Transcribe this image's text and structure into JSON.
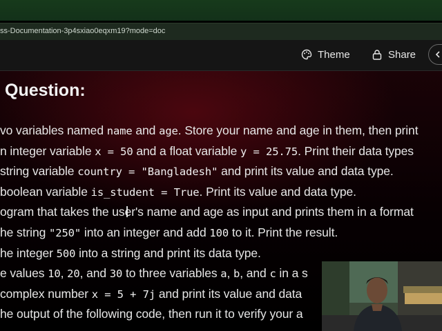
{
  "browser": {
    "url": "ss-Documentation-3p4sxiao0eqxm19?mode=doc"
  },
  "header": {
    "theme_label": "Theme",
    "share_label": "Share"
  },
  "doc": {
    "title": "Question:",
    "lines": [
      {
        "parts": [
          {
            "t": "vo variables named "
          },
          {
            "c": "name"
          },
          {
            "t": " and "
          },
          {
            "c": "age"
          },
          {
            "t": ". Store your name and age in them, then print"
          }
        ]
      },
      {
        "parts": [
          {
            "t": "n integer variable "
          },
          {
            "c": "x = 50"
          },
          {
            "t": " and a float variable "
          },
          {
            "c": "y = 25.75"
          },
          {
            "t": ". Print their data types"
          }
        ]
      },
      {
        "parts": [
          {
            "t": "string variable "
          },
          {
            "c": "country = \"Bangladesh\""
          },
          {
            "t": " and print its value and data type."
          }
        ]
      },
      {
        "parts": [
          {
            "t": "boolean variable "
          },
          {
            "c": "is_student = True"
          },
          {
            "t": ". Print its value and data type."
          }
        ]
      },
      {
        "parts": [
          {
            "t": "ogram that takes the user's name and age as input and prints them in a format"
          }
        ]
      },
      {
        "parts": [
          {
            "t": "he string "
          },
          {
            "c": "\"250\""
          },
          {
            "t": " into an integer and add "
          },
          {
            "c": "100"
          },
          {
            "t": " to it. Print the result."
          }
        ]
      },
      {
        "parts": [
          {
            "t": "he integer "
          },
          {
            "c": "500"
          },
          {
            "t": " into a string and print its data type."
          }
        ]
      },
      {
        "parts": [
          {
            "t": "e values "
          },
          {
            "c": "10"
          },
          {
            "t": ", "
          },
          {
            "c": "20"
          },
          {
            "t": ", and "
          },
          {
            "c": "30"
          },
          {
            "t": " to three variables "
          },
          {
            "c": "a"
          },
          {
            "t": ", "
          },
          {
            "c": "b"
          },
          {
            "t": ", and "
          },
          {
            "c": "c"
          },
          {
            "t": " in a s"
          }
        ]
      },
      {
        "parts": [
          {
            "t": "complex number "
          },
          {
            "c": "x = 5 + 7j"
          },
          {
            "t": " and print its value and data"
          }
        ]
      },
      {
        "parts": [
          {
            "t": "he output of the following code, then run it to verify your a"
          }
        ]
      }
    ]
  }
}
